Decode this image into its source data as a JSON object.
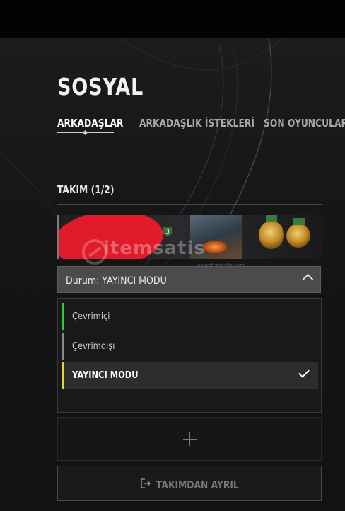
{
  "header": {
    "title": "SOSYAL"
  },
  "tabs": [
    {
      "label": "ARKADAŞLAR",
      "active": true
    },
    {
      "label": "ARKADAŞLIK İSTEKLERİ",
      "active": false
    },
    {
      "label": "SON OYUNCULAR",
      "active": false
    }
  ],
  "team": {
    "label": "TAKIM (1/2)",
    "player": {
      "level_badge": "3"
    },
    "status_select": {
      "value": "Durum: YAYINCI MODU"
    },
    "status_options": [
      {
        "label": "Çevrimiçi",
        "color": "#2ecc40",
        "selected": false
      },
      {
        "label": "Çevrimdışı",
        "color": "#8a8a8a",
        "selected": false
      },
      {
        "label": "YAYINCI MODU",
        "color": "#e8d23a",
        "selected": true
      }
    ],
    "leave_button": "TAKIMDAN AYRIL"
  },
  "watermark": {
    "text": "itemsatis",
    "small": "www.itemsatis.com"
  },
  "colors": {
    "accent_red": "#e11b2a",
    "background": "#121212"
  },
  "icons": {
    "leave": "exit-arrow-icon",
    "add": "plus-icon",
    "chevron": "chevron-up-icon",
    "check": "checkmark-icon"
  }
}
